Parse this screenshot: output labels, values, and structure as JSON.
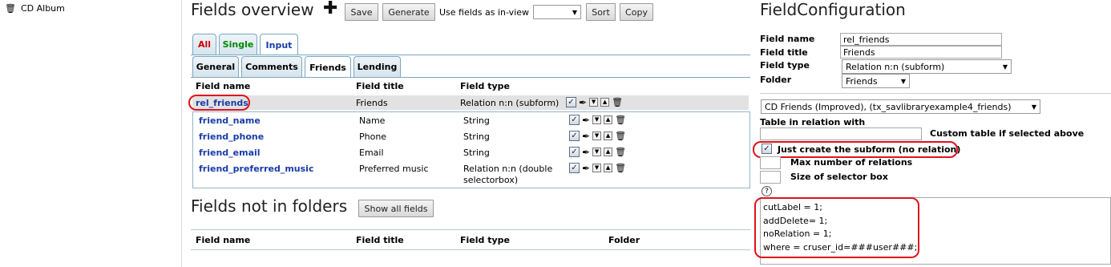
{
  "tree": {
    "item_label": "CD Album"
  },
  "header": {
    "title": "Fields overview",
    "save_label": "Save",
    "generate_label": "Generate",
    "use_fields_label": "Use fields as in-view",
    "use_fields_value": "",
    "sort_label": "Sort",
    "copy_label": "Copy"
  },
  "top_tabs": [
    {
      "label": "All",
      "color": "#cc0000"
    },
    {
      "label": "Single",
      "color": "#008800"
    },
    {
      "label": "Input",
      "color": "#1a3ca8"
    }
  ],
  "folder_tabs": [
    {
      "label": "General"
    },
    {
      "label": "Comments"
    },
    {
      "label": "Friends"
    },
    {
      "label": "Lending"
    }
  ],
  "fields_table": {
    "headers": {
      "name": "Field name",
      "title": "Field title",
      "type": "Field type"
    },
    "main_row": {
      "name": "rel_friends",
      "title": "Friends",
      "type": "Relation n:n (subform)"
    },
    "sub_rows": [
      {
        "name": "friend_name",
        "title": "Name",
        "type": "String",
        "type2": ""
      },
      {
        "name": "friend_phone",
        "title": "Phone",
        "type": "String",
        "type2": ""
      },
      {
        "name": "friend_email",
        "title": "Email",
        "type": "String",
        "type2": ""
      },
      {
        "name": "friend_preferred_music",
        "title": "Preferred music",
        "type": "Relation n:n (double",
        "type2": "selectorbox)"
      }
    ]
  },
  "not_in_folders": {
    "title": "Fields not in folders",
    "show_all_label": "Show all fields",
    "headers": {
      "name": "Field name",
      "title": "Field title",
      "type": "Field type",
      "folder": "Folder"
    }
  },
  "config": {
    "title": "FieldConfiguration",
    "field_name_label": "Field name",
    "field_name_value": "rel_friends",
    "field_title_label": "Field title",
    "field_title_value": "Friends",
    "field_type_label": "Field type",
    "field_type_value": "Relation n:n (subform)",
    "folder_label": "Folder",
    "folder_value": "Friends",
    "relation_value": "CD Friends (Improved), (tx_savlibraryexample4_friends)",
    "table_relation_label": "Table in relation with",
    "custom_table_label": "Custom table if selected above",
    "just_create_label": "Just create the subform (no relation)",
    "max_relations_label": "Max number of relations",
    "selector_size_label": "Size of selector box",
    "help_glyph": "?",
    "code_lines": [
      "cutLabel = 1;",
      "addDelete= 1;",
      "noRelation = 1;",
      "where = cruser_id=###user###;"
    ]
  },
  "icons": {
    "trash": "trash-icon",
    "checkbox": "checkbox-icon",
    "edit": "feather-edit-icon",
    "down": "arrow-down-icon",
    "up": "arrow-up-icon",
    "plus": "plus-icon",
    "help": "help-icon"
  },
  "colors": {
    "link": "#1a3ca8",
    "highlight": "#e0121b",
    "tab_border": "#7aa7c2"
  }
}
